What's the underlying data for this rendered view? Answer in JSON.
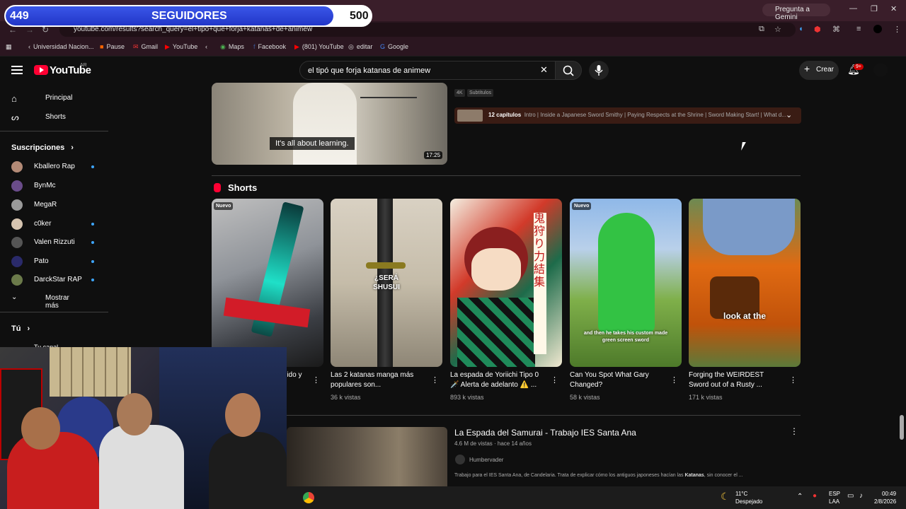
{
  "overlay": {
    "followers_current": "449",
    "followers_label": "SEGUIDORES",
    "followers_goal": "500",
    "progress": 0.898
  },
  "browser": {
    "gemini": "Pregunta a Gemini",
    "url": "youtube.com/results?search_query=el+tipó+que+forja+katanas+de+animew",
    "bookmarks": [
      "Universidad Nacion...",
      "Pause",
      "Gmail",
      "YouTube",
      "Maps",
      "Facebook",
      "(801) YouTube",
      "editar",
      "Google"
    ]
  },
  "youtube": {
    "logo": "YouTube",
    "region": "AR",
    "search_value": "el tipó que forja katanas de animew",
    "create_label": "Crear",
    "notifications": "9+"
  },
  "sidebar": {
    "home": "Principal",
    "shorts": "Shorts",
    "subs_header": "Suscripciones",
    "subscriptions": [
      {
        "name": "Kballero Rap",
        "new": true
      },
      {
        "name": "BynMc",
        "new": false
      },
      {
        "name": "MegaR",
        "new": false
      },
      {
        "name": "c0ker",
        "new": true
      },
      {
        "name": "Valen Rizzuti",
        "new": true
      },
      {
        "name": "Pato",
        "new": true
      },
      {
        "name": "DarckStar RAP",
        "new": true
      }
    ],
    "show_more": "Mostrar más",
    "you": "Tú",
    "your_channel": "Tu canal"
  },
  "top_video": {
    "caption": "It's all about learning.",
    "duration": "17:25",
    "badges": [
      "4K",
      "Subtítulos"
    ],
    "chapters_count": "12 capítulos",
    "chapters_text": "Intro | Inside a Japanese Sword Smithy | Paying Respects at the Shrine | Sword Making Start! | What d..."
  },
  "shorts": {
    "title": "Shorts",
    "items": [
      {
        "title": "...ido y",
        "views": "",
        "new": "Nuevo",
        "overlay": ""
      },
      {
        "title": "Las 2 katanas manga más populares son...",
        "views": "36 k vistas",
        "new": "",
        "overlay": "¿SERÁ SHUSUI"
      },
      {
        "title": "La espada de Yoriichi Tipo 0 🗡️ Alerta de adelanto ⚠️ ...",
        "views": "893 k vistas",
        "new": "",
        "overlay": ""
      },
      {
        "title": "Can You Spot What Gary Changed?",
        "views": "58 k vistas",
        "new": "Nuevo",
        "overlay": "and then he takes his custom made green screen sword"
      },
      {
        "title": "Forging the WEIRDEST Sword out of a Rusty ...",
        "views": "171 k vistas",
        "new": "",
        "overlay": "look at the"
      }
    ]
  },
  "video2": {
    "title": "La Espada del Samurai - Trabajo IES Santa Ana",
    "meta": "4.6 M de vistas · hace 14 años",
    "channel": "Humbervader",
    "desc_before": "Trabajo para el IES Santa Ana, de Candelaria. Trata de explicar cómo los antiguos japoneses hacían las ",
    "desc_bold": "Katanas",
    "desc_after": ", sin conocer el ..."
  },
  "taskbar": {
    "temp": "11°C",
    "weather": "Despejado",
    "lang1": "ESP",
    "lang2": "LAA",
    "time": "00:49",
    "date": "2/8/2026"
  }
}
